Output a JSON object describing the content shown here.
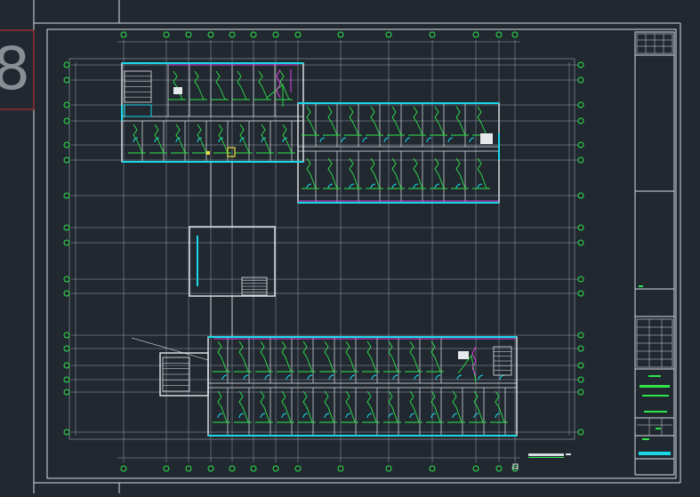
{
  "colors": {
    "background": "#212830",
    "border": "#d8dde2",
    "grid": "#9aa3ad",
    "wall": "#e6e9ec",
    "cyan": "#19d8e8",
    "green": "#2ee64a",
    "magenta": "#e040e0",
    "yellow": "#f0e040",
    "red": "#c83030",
    "tab_text": "#8a8f96"
  },
  "sheet_tab": {
    "label": "8"
  },
  "drawing": {
    "kind": "floor-plan"
  }
}
